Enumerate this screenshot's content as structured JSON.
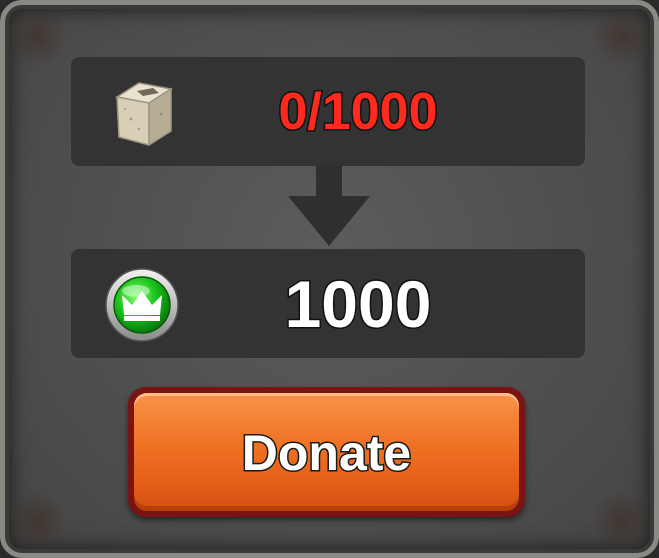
{
  "cost": {
    "icon": "stone-block-icon",
    "amount_text": "0/1000",
    "color": "#ff2a1e"
  },
  "reward": {
    "icon": "crown-gem-icon",
    "amount_text": "1000",
    "color": "#ffffff"
  },
  "donate_button": {
    "label": "Donate",
    "color": "#f07526"
  }
}
